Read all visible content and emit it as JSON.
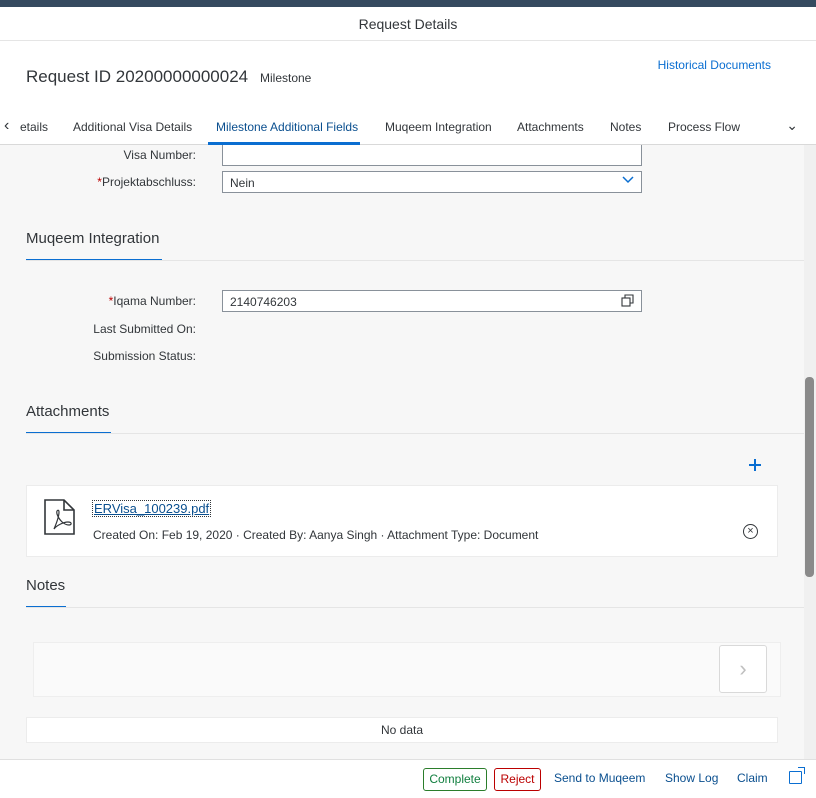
{
  "window": {
    "title": "Request Details"
  },
  "header": {
    "title": "Request ID 20200000000024",
    "subtitle": "Milestone",
    "historical_link": "Historical Documents"
  },
  "tabs": [
    {
      "label": "etails"
    },
    {
      "label": "Additional Visa Details"
    },
    {
      "label": "Milestone Additional Fields",
      "active": true
    },
    {
      "label": "Muqeem Integration"
    },
    {
      "label": "Attachments"
    },
    {
      "label": "Notes"
    },
    {
      "label": "Process Flow"
    }
  ],
  "milestone_fields": {
    "visa_number_label": "Visa Number:",
    "visa_number_value": "",
    "projekt_label": "Projektabschluss:",
    "projekt_value": "Nein"
  },
  "muqeem": {
    "section_title": "Muqeem Integration",
    "iqama_label": "Iqama Number:",
    "iqama_value": "2140746203",
    "last_submitted_label": "Last Submitted On:",
    "last_submitted_value": "",
    "status_label": "Submission Status:",
    "status_value": ""
  },
  "attachments": {
    "section_title": "Attachments",
    "items": [
      {
        "file_name": "ERVisa_100239.pdf",
        "meta": "Created On: Feb 19, 2020 · Created By: Aanya Singh · Attachment Type: Document"
      }
    ]
  },
  "notes": {
    "section_title": "Notes",
    "input_value": "",
    "empty_text": "No data"
  },
  "footer": {
    "complete": "Complete",
    "reject": "Reject",
    "send": "Send to Muqeem",
    "show_log": "Show Log",
    "claim": "Claim"
  },
  "icons": {
    "tabs_left": "chevron-left-icon",
    "tabs_right": "chevron-down-icon",
    "dropdown": "chevron-down-icon",
    "value_help": "copy-icon",
    "add": "plus-icon",
    "pdf": "pdf-file-icon",
    "remove": "close-circle-icon",
    "notes_submit": "chevron-right-icon",
    "share": "share-icon"
  },
  "colors": {
    "accent": "#0a6ed1",
    "complete": "#107e3e",
    "reject": "#bb0000",
    "required": "#bb0000"
  }
}
